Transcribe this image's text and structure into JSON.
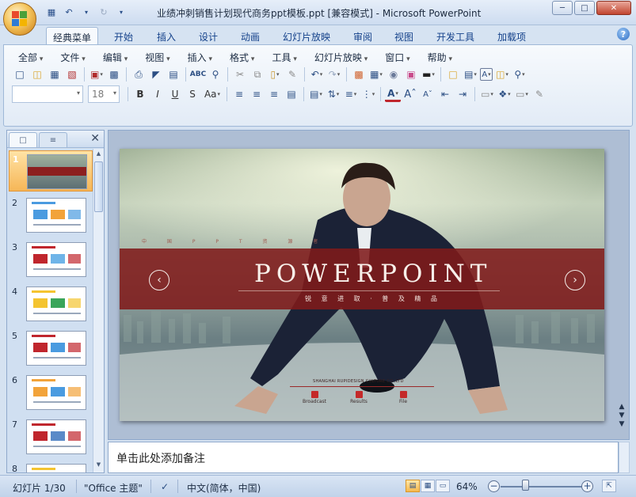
{
  "window": {
    "title": "业绩冲刺销售计划现代商务ppt模板.ppt [兼容模式] - Microsoft PowerPoint",
    "minimize_icon": "minimize-icon",
    "maximize_icon": "maximize-icon",
    "close_icon": "close-icon"
  },
  "ribbon_tabs": [
    "经典菜单",
    "开始",
    "插入",
    "设计",
    "动画",
    "幻灯片放映",
    "审阅",
    "视图",
    "开发工具",
    "加载项"
  ],
  "active_tab": "经典菜单",
  "classic_menus": [
    "全部",
    "文件",
    "编辑",
    "视图",
    "插入",
    "格式",
    "工具",
    "幻灯片放映",
    "窗口",
    "帮助"
  ],
  "format_bar": {
    "font_name": "",
    "font_size": "18",
    "bold": "B",
    "italic": "I",
    "underline": "U",
    "strike": "S",
    "case": "Aa"
  },
  "slides_panel": {
    "slide_numbers": [
      "1",
      "2",
      "3",
      "4",
      "5",
      "6",
      "7",
      "8"
    ],
    "selected_index": 1
  },
  "slide": {
    "top_text": "中 国 P P T 资 源 者",
    "title": "POWERPOINT",
    "subtitle": "锐 意 进 取 · 普 及 精 品",
    "company": "SHANGHAI RUPIDESIGN CULTURE CO.,LTD",
    "buttons": [
      "Broadcast",
      "Results",
      "File"
    ],
    "prev_arrow": "‹",
    "next_arrow": "›",
    "accent_color": "#801a1a"
  },
  "notes": {
    "placeholder": "单击此处添加备注"
  },
  "status": {
    "slide_info": "幻灯片 1/30",
    "theme": "\"Office 主题\"",
    "language": "中文(简体，中国)",
    "zoom": "64%",
    "zoom_level": 0.3
  }
}
